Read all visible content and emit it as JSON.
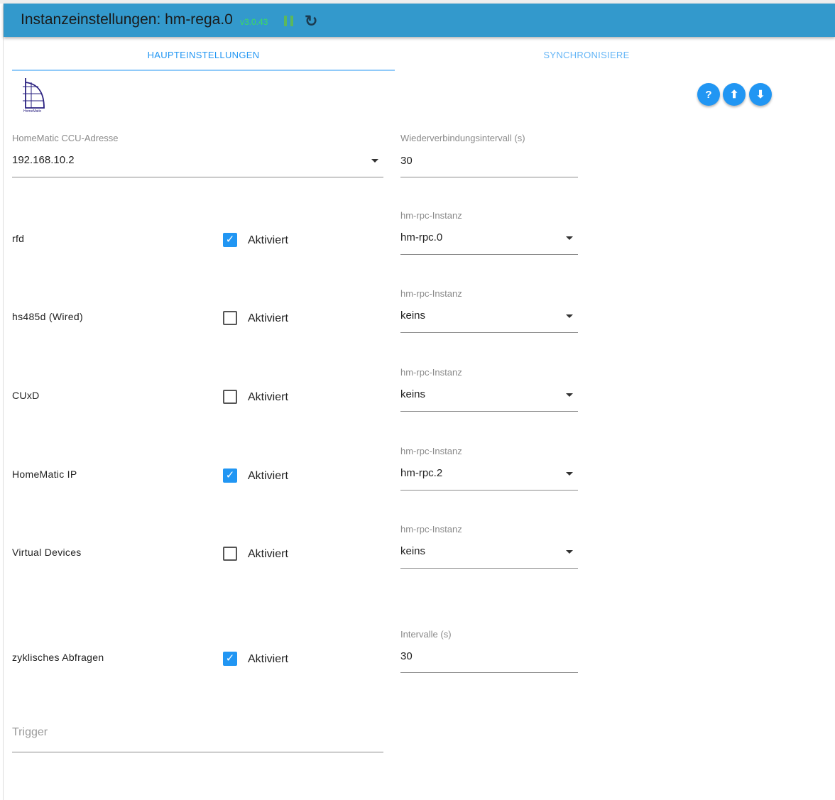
{
  "header": {
    "title": "Instanzeinstellungen: hm-rega.0",
    "version": "v3.0.43"
  },
  "tabs": [
    {
      "label": "HAUPTEINSTELLUNGEN"
    },
    {
      "label": "SYNCHRONISIERE"
    }
  ],
  "logo": {
    "text": "HomeMatic"
  },
  "actions": [
    {
      "icon": "help-icon",
      "glyph": "?"
    },
    {
      "icon": "upload-icon",
      "glyph": "⬆"
    },
    {
      "icon": "download-icon",
      "glyph": "⬇"
    }
  ],
  "ccu": {
    "label": "HomeMatic CCU-Adresse",
    "value": "192.168.10.2"
  },
  "reconnect": {
    "label": "Wiederverbindungsintervall (s)",
    "value": "30"
  },
  "checkbox_label": "Aktiviert",
  "rows": [
    {
      "label": "rfd",
      "checked": true,
      "select_label": "hm-rpc-Instanz",
      "select_value": "hm-rpc.0"
    },
    {
      "label": "hs485d (Wired)",
      "checked": false,
      "select_label": "hm-rpc-Instanz",
      "select_value": "keins"
    },
    {
      "label": "CUxD",
      "checked": false,
      "select_label": "hm-rpc-Instanz",
      "select_value": "keins"
    },
    {
      "label": "HomeMatic IP",
      "checked": true,
      "select_label": "hm-rpc-Instanz",
      "select_value": "hm-rpc.2"
    },
    {
      "label": "Virtual Devices",
      "checked": false,
      "select_label": "hm-rpc-Instanz",
      "select_value": "keins"
    }
  ],
  "polling": {
    "label": "zyklisches Abfragen",
    "checked": true,
    "interval_label": "Intervalle (s)",
    "interval_value": "30"
  },
  "trigger": {
    "placeholder": "Trigger"
  }
}
